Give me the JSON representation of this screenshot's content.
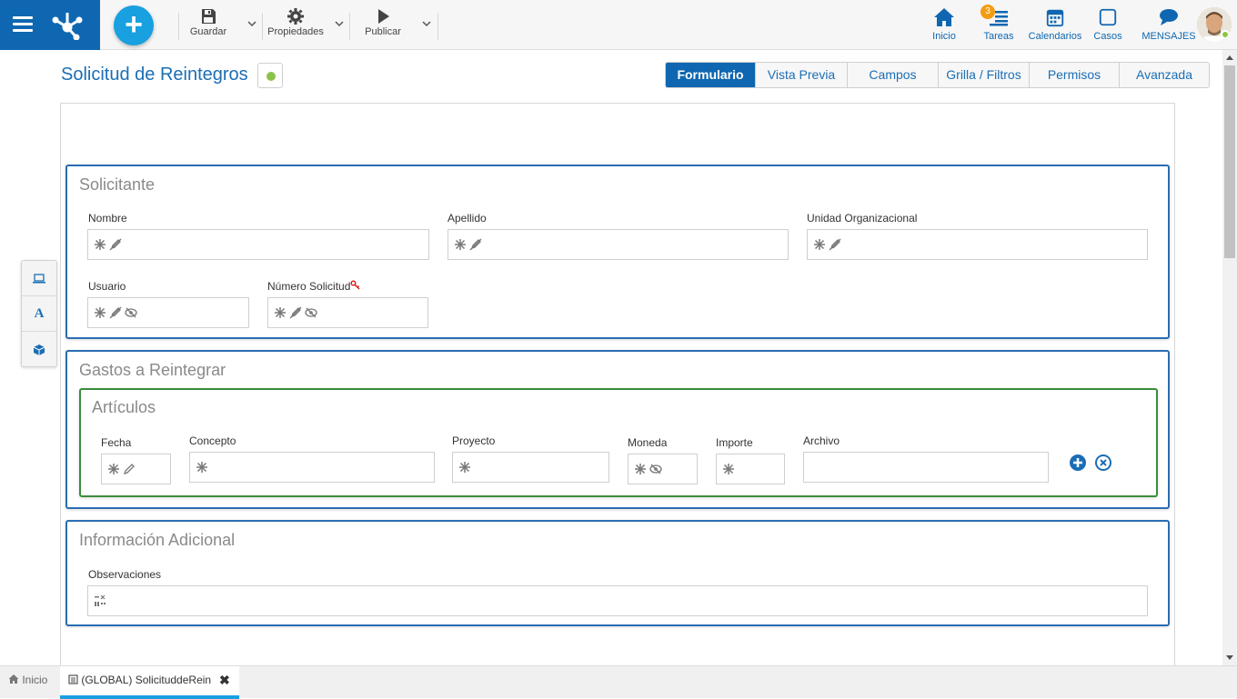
{
  "toolbar": {
    "save_label": "Guardar",
    "properties_label": "Propiedades",
    "publish_label": "Publicar"
  },
  "nav": {
    "home": "Inicio",
    "tasks": "Tareas",
    "tasks_badge": "3",
    "calendars": "Calendarios",
    "cases": "Casos",
    "messages": "MENSAJES"
  },
  "page": {
    "title": "Solicitud de Reintegros",
    "status_color": "#8bc34a"
  },
  "tabs": [
    {
      "label": "Formulario",
      "active": true
    },
    {
      "label": "Vista Previa",
      "active": false
    },
    {
      "label": "Campos",
      "active": false
    },
    {
      "label": "Grilla / Filtros",
      "active": false
    },
    {
      "label": "Permisos",
      "active": false
    },
    {
      "label": "Avanzada",
      "active": false
    }
  ],
  "sections": {
    "solicitante": {
      "title": "Solicitante",
      "fields": {
        "nombre": "Nombre",
        "apellido": "Apellido",
        "unidad": "Unidad Organizacional",
        "usuario": "Usuario",
        "numero": "Número Solicitud"
      }
    },
    "gastos": {
      "title": "Gastos a Reintegrar",
      "articulos": {
        "title": "Artículos",
        "columns": {
          "fecha": "Fecha",
          "concepto": "Concepto",
          "proyecto": "Proyecto",
          "moneda": "Moneda",
          "importe": "Importe",
          "archivo": "Archivo"
        }
      }
    },
    "adicional": {
      "title": "Información Adicional",
      "fields": {
        "observaciones": "Observaciones"
      }
    }
  },
  "bottom_tabs": {
    "home": "Inicio",
    "current": "(GLOBAL) SolicituddeRein"
  },
  "colors": {
    "brand": "#0f67b1",
    "accent": "#18a0e0",
    "section_border": "#2a6db3",
    "grid_border": "#3b8d3b"
  }
}
